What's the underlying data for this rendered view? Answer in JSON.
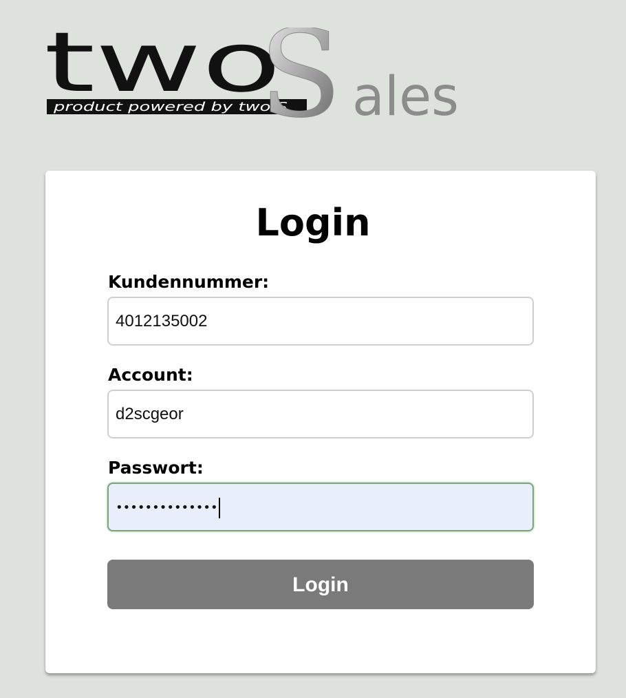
{
  "logo": {
    "brand_word": "two",
    "brand_big_letter": "S",
    "brand_rest": "ales",
    "tagline": "product powered by two S"
  },
  "login_form": {
    "title": "Login",
    "customer_number_label": "Kundennummer:",
    "customer_number_value": "4012135002",
    "account_label": "Account:",
    "account_value": "d2scgeor",
    "password_label": "Passwort:",
    "password_masked": "••••••••••••••",
    "submit_label": "Login"
  },
  "colors": {
    "background": "#dde3dc",
    "card": "#ffffff",
    "button": "#7a7a7a",
    "focused_field": "#e8effa",
    "focus_border": "#7ea47e"
  }
}
